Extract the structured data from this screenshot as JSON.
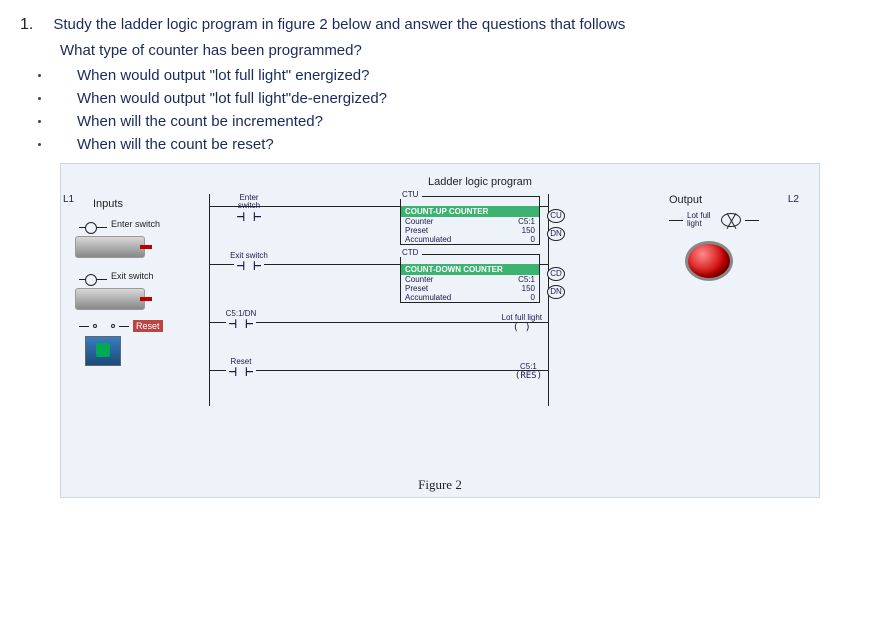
{
  "question": {
    "number": "1.",
    "main": "Study the ladder logic program in figure 2 below and answer the questions that follows",
    "sub1": "What type of counter has been programmed?",
    "bullets": [
      "When would output \"lot full light\" energized?",
      "When would output \"lot full light\"de-energized?",
      "When will the count be incremented?",
      "When will the count be reset?"
    ]
  },
  "diagram": {
    "title": "Ladder logic program",
    "caption": "Figure 2",
    "inputs": {
      "rail_left": "L1",
      "header": "Inputs",
      "enter_switch": "Enter switch",
      "exit_switch": "Exit switch",
      "reset": "Reset"
    },
    "outputs": {
      "rail_right": "L2",
      "header": "Output",
      "lot_full": "Lot full light"
    },
    "rung1": {
      "contact": "Enter switch",
      "box_type": "CTU",
      "box_title": "COUNT-UP COUNTER",
      "counter_lbl": "Counter",
      "counter_val": "C5:1",
      "preset_lbl": "Preset",
      "preset_val": "150",
      "acc_lbl": "Accumulated",
      "acc_val": "0",
      "out1": "CU",
      "out2": "DN"
    },
    "rung2": {
      "contact": "Exit switch",
      "box_type": "CTD",
      "box_title": "COUNT-DOWN COUNTER",
      "counter_lbl": "Counter",
      "counter_val": "C5:1",
      "preset_lbl": "Preset",
      "preset_val": "150",
      "acc_lbl": "Accumulated",
      "acc_val": "0",
      "out1": "CD",
      "out2": "DN"
    },
    "rung3": {
      "contact": "C5:1/DN",
      "coil": "Lot full light"
    },
    "rung4": {
      "contact": "Reset",
      "res_tag": "C5:1",
      "res": "RES"
    }
  }
}
